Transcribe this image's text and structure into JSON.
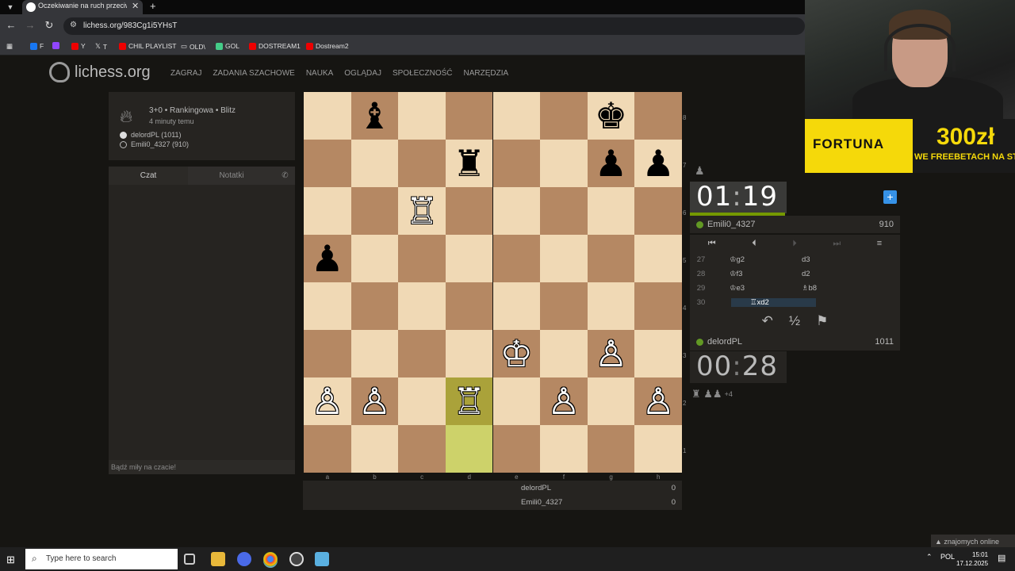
{
  "browser": {
    "tab_title": "Oczekiwanie na ruch przeciwnika",
    "url": "lichess.org/983Cg1i5YHsT",
    "bookmarks": [
      "F",
      "Y",
      "T",
      "CHIL PLAYLIST",
      "OLD\\",
      "GOL",
      "DOSTREAM1",
      "Dostream2"
    ]
  },
  "site": {
    "logo_text": "lichess.org",
    "nav": [
      "ZAGRAJ",
      "ZADANIA SZACHOWE",
      "NAUKA",
      "OGLĄDAJ",
      "SPOŁECZNOŚĆ",
      "NARZĘDZIA"
    ]
  },
  "game_info": {
    "mode": "3+0 • Rankingowa • Blitz",
    "time_ago": "4 minuty temu",
    "white_player": "delordPL (1011)",
    "black_player": "Emili0_4327 (910)"
  },
  "chat": {
    "tab_chat": "Czat",
    "tab_notes": "Notatki",
    "placeholder": "Bądź miły na czacie!"
  },
  "board": {
    "files": [
      "a",
      "b",
      "c",
      "d",
      "e",
      "f",
      "g",
      "h"
    ],
    "ranks": [
      "8",
      "7",
      "6",
      "5",
      "4",
      "3",
      "2",
      "1"
    ],
    "pieces": [
      {
        "sq": "b8",
        "p": "♝",
        "c": "b"
      },
      {
        "sq": "g8",
        "p": "♚",
        "c": "b"
      },
      {
        "sq": "d7",
        "p": "♜",
        "c": "b"
      },
      {
        "sq": "g7",
        "p": "♟",
        "c": "b"
      },
      {
        "sq": "h7",
        "p": "♟",
        "c": "b"
      },
      {
        "sq": "c6",
        "p": "♖",
        "c": "w"
      },
      {
        "sq": "a5",
        "p": "♟",
        "c": "b"
      },
      {
        "sq": "e3",
        "p": "♔",
        "c": "w"
      },
      {
        "sq": "g3",
        "p": "♙",
        "c": "w"
      },
      {
        "sq": "a2",
        "p": "♙",
        "c": "w"
      },
      {
        "sq": "b2",
        "p": "♙",
        "c": "w"
      },
      {
        "sq": "d2",
        "p": "♖",
        "c": "w"
      },
      {
        "sq": "f2",
        "p": "♙",
        "c": "w"
      },
      {
        "sq": "h2",
        "p": "♙",
        "c": "w"
      }
    ],
    "highlights": [
      "d2",
      "d1"
    ]
  },
  "score": {
    "rows": [
      {
        "name": "delordPL",
        "points": "0"
      },
      {
        "name": "Emili0_4327",
        "points": "0"
      }
    ]
  },
  "clocks": {
    "top": {
      "min": "01",
      "sec": "19",
      "player": "Emili0_4327",
      "rating": "910"
    },
    "bottom": {
      "min": "00",
      "sec": "28",
      "player": "delordPL",
      "rating": "1011"
    }
  },
  "moves": [
    {
      "num": "27",
      "w": "♔g2",
      "b": "d3"
    },
    {
      "num": "28",
      "w": "♔f3",
      "b": "d2"
    },
    {
      "num": "29",
      "w": "♔e3",
      "b": "♗b8"
    },
    {
      "num": "30",
      "w": "♖xd2",
      "b": ""
    }
  ],
  "captured": {
    "pieces": "♜ ♟♟",
    "plus": "+4"
  },
  "ad": {
    "brand": "FORTUNA",
    "amount": "300zł",
    "subtitle": "WE FREEBETACH NA START"
  },
  "friends_online": "znajomych online",
  "taskbar": {
    "search": "Type here to search",
    "lang": "POL",
    "time": "15:01",
    "date": "17.12.2025"
  },
  "colors": {
    "light_square": "#f0d9b5",
    "dark_square": "#b58863",
    "highlight": "#cdd26a",
    "clock_bar": "#759900",
    "ad_yellow": "#f5d90a"
  }
}
